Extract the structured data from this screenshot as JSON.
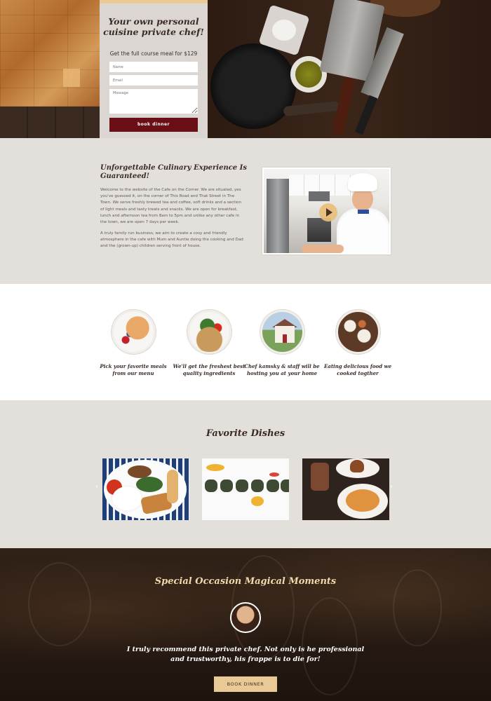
{
  "hero": {
    "form_title": "Your own personal cuisine private chef!",
    "form_subtitle": "Get the full course meal for $129",
    "name_placeholder": "Name",
    "email_placeholder": "Email",
    "message_placeholder": "Message",
    "submit_label": "book dinner"
  },
  "about": {
    "title": "Unforgettable Culinary Experience Is Guaranteed!",
    "paragraph1": "Welcome to the website of the Cafe on the Corner. We are situated, yes you've guessed it, on the corner of This Road and That Street in The Town. We serve freshly brewed tea and coffee, soft drinks and a section of light meals and tasty treats and snacks. We are open for breakfast, lunch and afternoon tea from 8am to 5pm and unlike any other cafe in the town, we are open 7 days per week.",
    "paragraph2": "A truly family run business, we aim to create a cosy and friendly atmosphere in the cafe with Mum and Auntie doing the cooking and Dad and the (grown-up) children serving front of house.",
    "video_icon": "play-icon"
  },
  "steps": [
    {
      "label": "Pick your favorite meals from our menu"
    },
    {
      "label": "We'll get the freshest best quality ingredients"
    },
    {
      "label": "Chef kamsky & staff will be hosting you at your home"
    },
    {
      "label": "Eating delicious food we cooked togther"
    }
  ],
  "dishes": {
    "title": "Favorite Dishes",
    "prev_icon": "‹",
    "next_icon": "›"
  },
  "testimonial": {
    "title": "Special Occasion Magical Moments",
    "quote": "I truly recommend this private chef. Not only is he professional and trustworthy, his frappe is to die for!",
    "button_label": "BOOK DINNER"
  },
  "colors": {
    "accent": "#e9c996",
    "button_dark": "#6b0f17",
    "section_bg": "#e3dfdb"
  }
}
